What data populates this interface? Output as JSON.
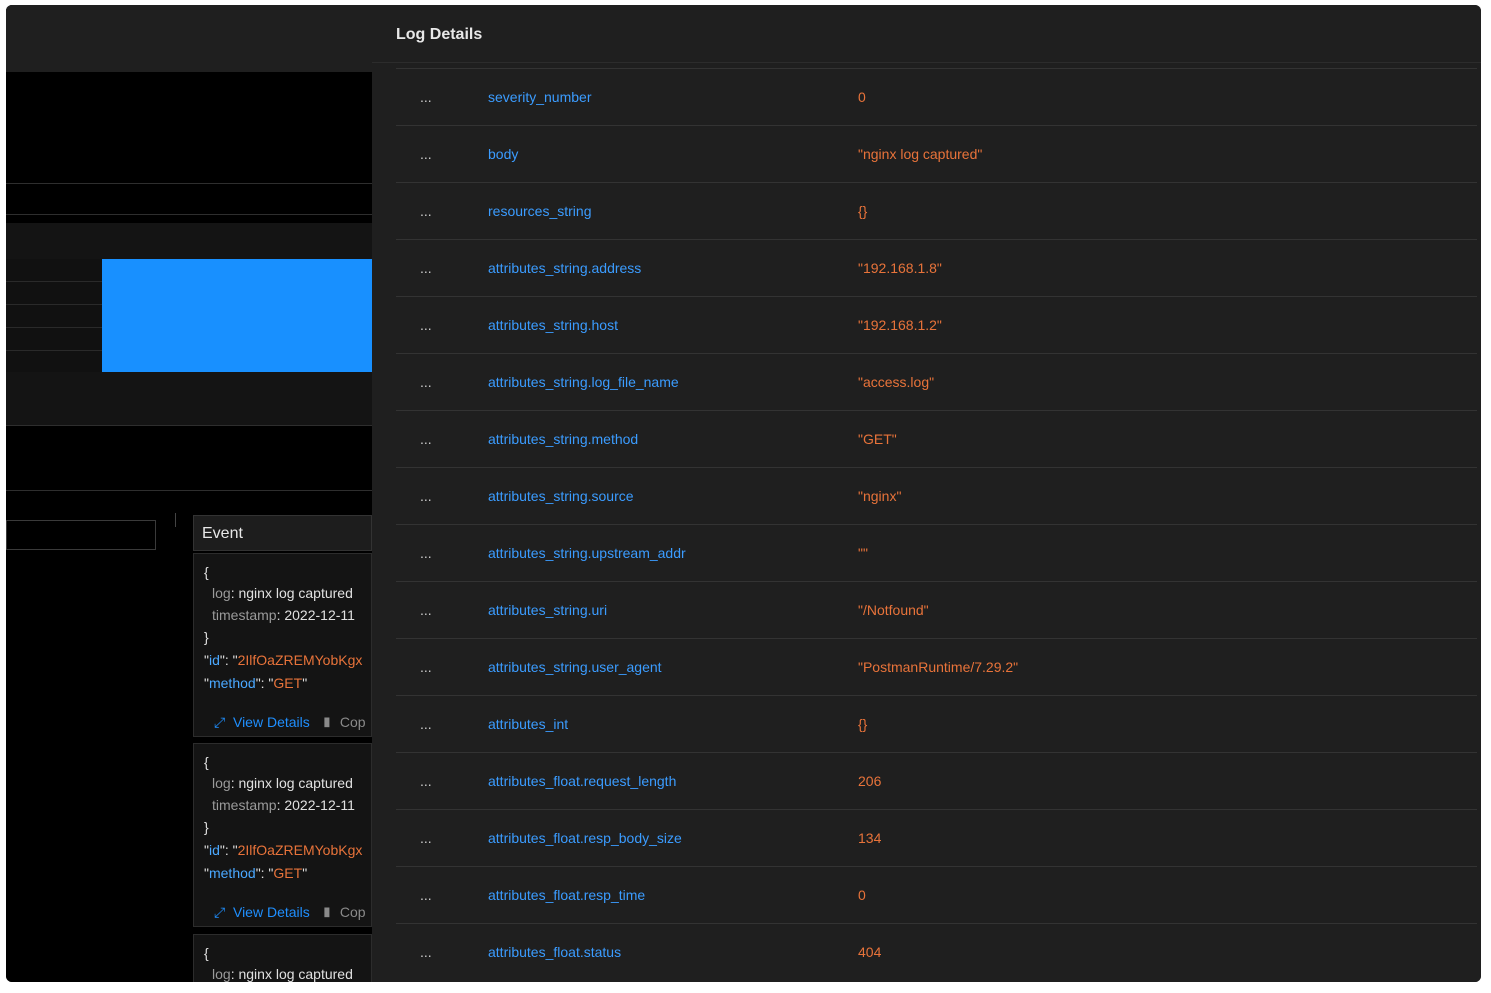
{
  "drawer": {
    "title": "Log Details",
    "rows": [
      {
        "dots": "...",
        "field": "severity_number",
        "value": "0"
      },
      {
        "dots": "...",
        "field": "body",
        "value": "\"nginx log captured\""
      },
      {
        "dots": "...",
        "field": "resources_string",
        "value": "{}"
      },
      {
        "dots": "...",
        "field": "attributes_string.address",
        "value": "\"192.168.1.8\""
      },
      {
        "dots": "...",
        "field": "attributes_string.host",
        "value": "\"192.168.1.2\""
      },
      {
        "dots": "...",
        "field": "attributes_string.log_file_name",
        "value": "\"access.log\""
      },
      {
        "dots": "...",
        "field": "attributes_string.method",
        "value": "\"GET\""
      },
      {
        "dots": "...",
        "field": "attributes_string.source",
        "value": "\"nginx\""
      },
      {
        "dots": "...",
        "field": "attributes_string.upstream_addr",
        "value": "\"\""
      },
      {
        "dots": "...",
        "field": "attributes_string.uri",
        "value": "\"/Notfound\""
      },
      {
        "dots": "...",
        "field": "attributes_string.user_agent",
        "value": "\"PostmanRuntime/7.29.2\""
      },
      {
        "dots": "...",
        "field": "attributes_int",
        "value": "{}"
      },
      {
        "dots": "...",
        "field": "attributes_float.request_length",
        "value": "206"
      },
      {
        "dots": "...",
        "field": "attributes_float.resp_body_size",
        "value": "134"
      },
      {
        "dots": "...",
        "field": "attributes_float.resp_time",
        "value": "0"
      },
      {
        "dots": "...",
        "field": "attributes_float.status",
        "value": "404"
      }
    ]
  },
  "events": {
    "header": "Event",
    "card": {
      "open_brace": "{",
      "close_brace": "}",
      "log_key": "log",
      "log_value": "nginx log captured",
      "timestamp_key": "timestamp",
      "timestamp_value": "2022-12-11",
      "id_key": "id",
      "id_value": "2IlfOaZREMYobKgx",
      "method_key": "method",
      "method_value": "GET",
      "view_details": "View Details",
      "copy": "Cop"
    }
  },
  "colors": {
    "accent": "#1890ff",
    "field": "#3b9cff",
    "value": "#e8733a",
    "background": "#1f1f1f"
  },
  "icons": {
    "view_details": "expand-icon",
    "copy": "copy-icon"
  }
}
